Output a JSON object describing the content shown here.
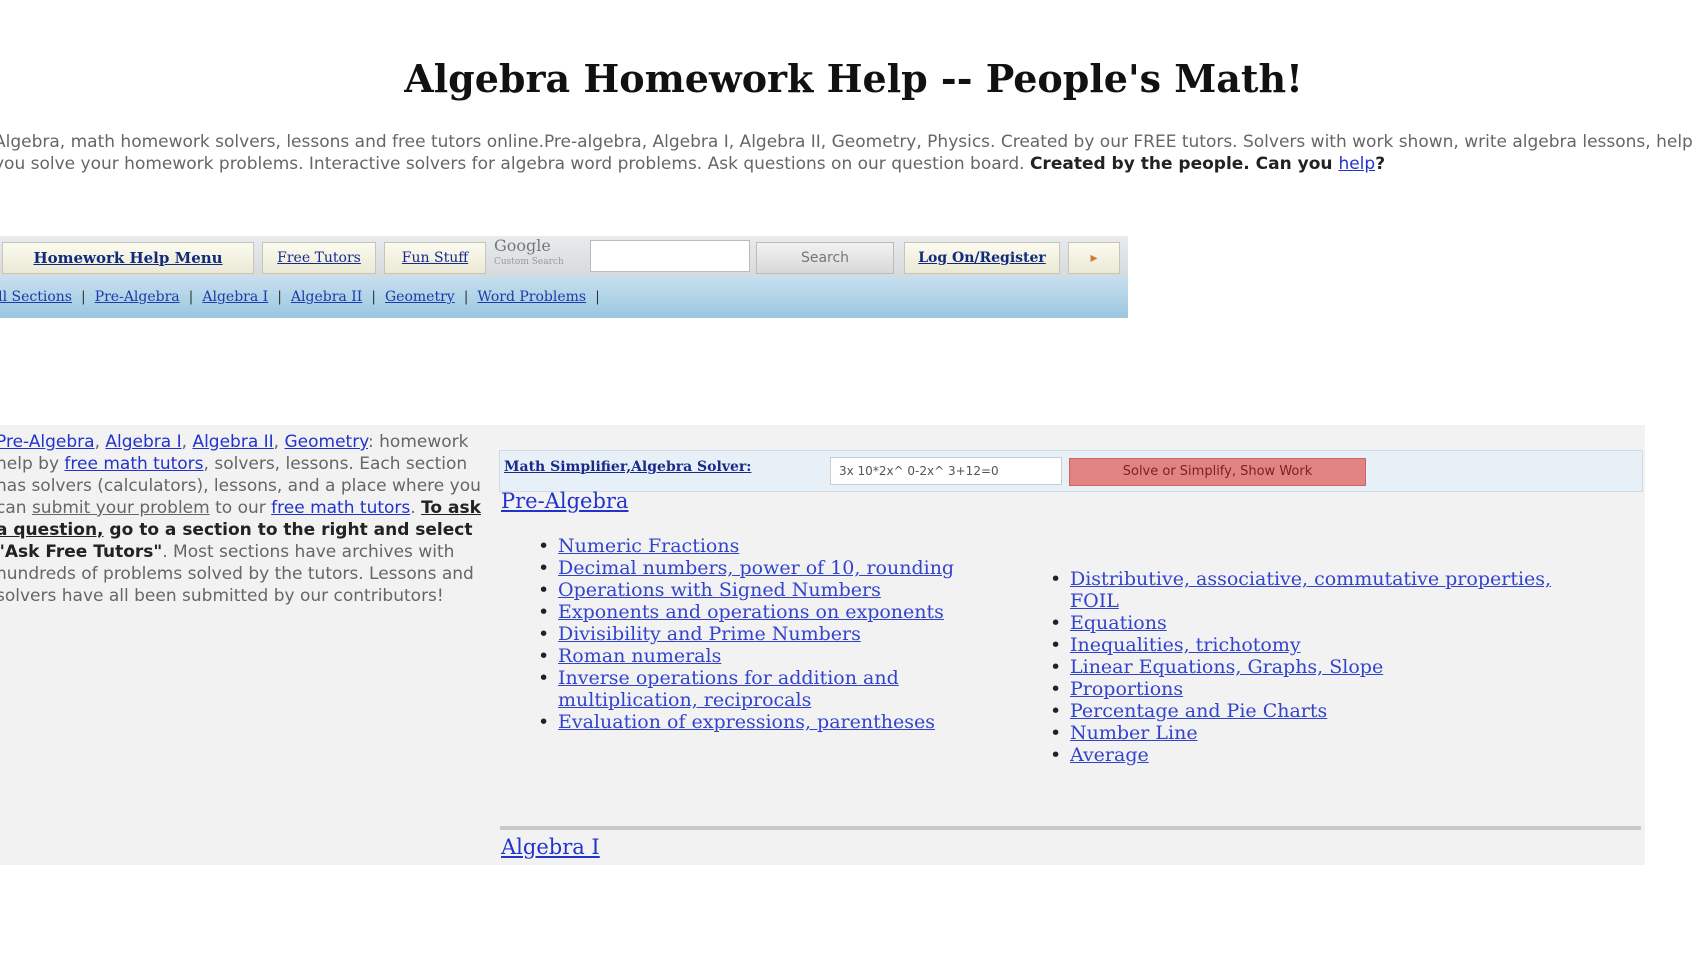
{
  "page": {
    "title": "Algebra Homework Help -- People's Math!"
  },
  "intro": {
    "text": "Algebra, math homework solvers, lessons and free tutors online.Pre-algebra, Algebra I, Algebra II, Geometry, Physics. Created by our FREE tutors. Solvers with work shown, write algebra lessons, help you solve your homework problems. Interactive solvers for algebra word problems. Ask questions on our question board. ",
    "bold": "Created by the people. Can you ",
    "help_link": "help",
    "end": "?"
  },
  "topnav": {
    "tabs": [
      {
        "label": "Homework Help Menu"
      },
      {
        "label": "Free Tutors"
      },
      {
        "label": "Fun Stuff"
      }
    ],
    "google_logo": "Google",
    "google_sub": "Custom Search",
    "search_button": "Search",
    "login": "Log On/Register",
    "more": "▸",
    "sublinks": [
      {
        "label": "All Sections"
      },
      {
        "label": "Pre-Algebra"
      },
      {
        "label": "Algebra I"
      },
      {
        "label": "Algebra II"
      },
      {
        "label": "Geometry"
      },
      {
        "label": "Word Problems"
      }
    ]
  },
  "leftcol": {
    "link1": "Pre-Algebra",
    "link2": "Algebra I",
    "link3": "Algebra II",
    "link4": "Geometry",
    "t1": ": homework help by ",
    "link5": "free math tutors",
    "t2": ", solvers, lessons. Each section has solvers (calculators), lessons, and a place where you can ",
    "link6": "submit your problem",
    "t3": " to our ",
    "link7": "free math tutors",
    "t4": ". ",
    "bold1": "To ask a question,",
    "bold2": " go to a section to the right and select \"Ask Free Tutors\"",
    "t5": ". Most sections have archives with hundreds of problems solved by the tutors. Lessons and solvers have all been submitted by our contributors!"
  },
  "solver": {
    "label": "Math Simplifier,Algebra Solver:",
    "input_value": "3x 10*2x^ 0-2x^ 3+12=0",
    "button": "Solve or Simplify, Show Work"
  },
  "prealgebra": {
    "title": "Pre-Algebra",
    "left_items": [
      "Numeric Fractions",
      "Decimal numbers, power of 10, rounding",
      "Operations with Signed Numbers",
      "Exponents and operations on exponents",
      "Divisibility and Prime Numbers",
      "Roman numerals",
      "Inverse operations for addition and multiplication, reciprocals",
      "Evaluation of expressions, parentheses"
    ],
    "right_items": [
      "Distributive, associative, commutative properties, FOIL",
      "Equations",
      "Inequalities, trichotomy",
      "Linear Equations, Graphs, Slope",
      "Proportions",
      "Percentage and Pie Charts",
      "Number Line",
      "Average"
    ]
  },
  "algebra1": {
    "title": "Algebra I"
  }
}
